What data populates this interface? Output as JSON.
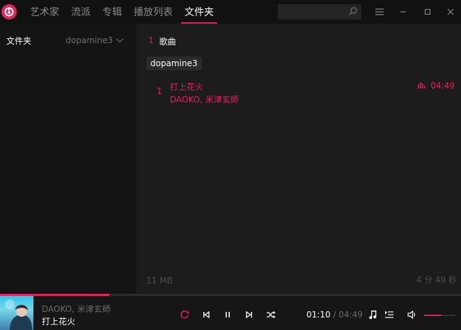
{
  "nav": {
    "items": [
      {
        "label": "艺术家",
        "active": false
      },
      {
        "label": "流派",
        "active": false
      },
      {
        "label": "专辑",
        "active": false
      },
      {
        "label": "播放列表",
        "active": false
      },
      {
        "label": "文件夹",
        "active": true
      }
    ]
  },
  "search": {
    "placeholder": "",
    "icon": "search-icon"
  },
  "window_controls": [
    "menu-icon",
    "minimize-icon",
    "maximize-icon",
    "close-icon"
  ],
  "sidebar": {
    "title": "文件夹",
    "folder_selected": "dopamine3",
    "dropdown_icon": "chevron-down-icon"
  },
  "main": {
    "count": "1",
    "count_label": "歌曲",
    "folder_chip": "dopamine3",
    "tracks": [
      {
        "index": "1",
        "title": "打上花火",
        "artist": "DAOKO, 米津玄師",
        "duration": "04:49",
        "playing": true
      }
    ],
    "footer_size": "11 MB",
    "footer_duration": "4 分 49 秒"
  },
  "player": {
    "artist": "DAOKO, 米津玄師",
    "title": "打上花火",
    "current_time": "01:10",
    "separator": "/",
    "total_time": "04:49",
    "progress_fraction": 0.237,
    "volume_fraction": 0.55
  },
  "colors": {
    "accent": "#e0245e",
    "background": "#1c1c1c",
    "sidebar": "#141414",
    "titlebar": "#111111"
  }
}
